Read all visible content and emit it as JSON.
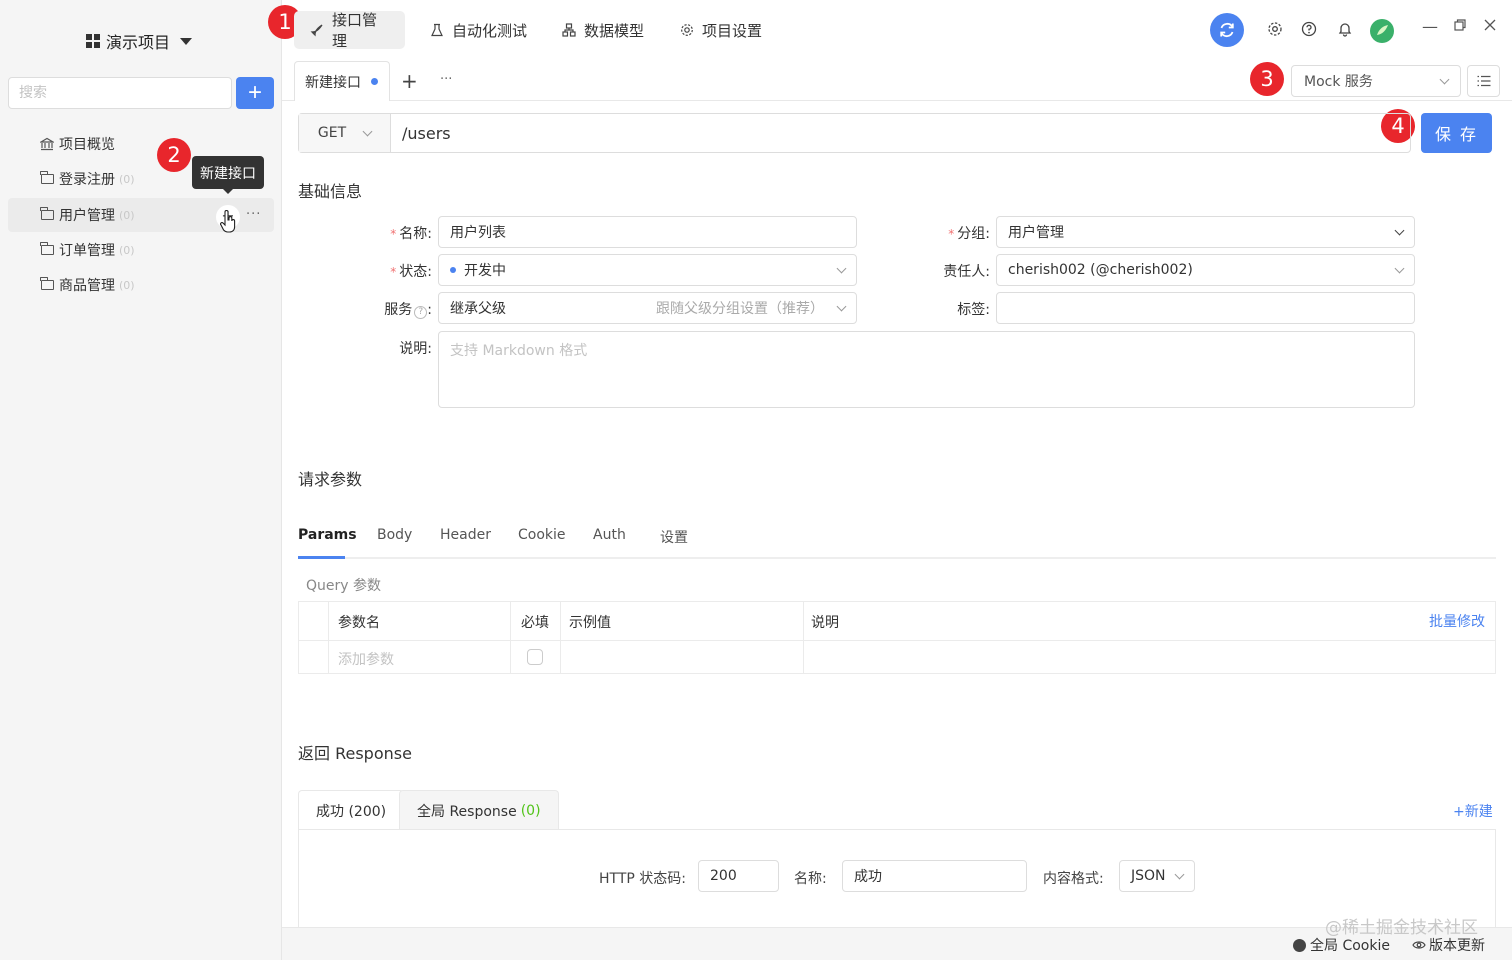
{
  "sidebar": {
    "project_name": "演示项目",
    "search_placeholder": "搜索",
    "add_label": "+",
    "items": [
      {
        "label": "项目概览",
        "count": ""
      },
      {
        "label": "登录注册",
        "count": "(0)"
      },
      {
        "label": "用户管理",
        "count": "(0)"
      },
      {
        "label": "订单管理",
        "count": "(0)"
      },
      {
        "label": "商品管理",
        "count": "(0)"
      }
    ],
    "tooltip": "新建接口"
  },
  "badges": [
    "1",
    "2",
    "3",
    "4"
  ],
  "top_nav": {
    "tabs": [
      "接口管理",
      "自动化测试",
      "数据模型",
      "项目设置"
    ]
  },
  "tabs": {
    "open_tab": "新建接口",
    "add": "+",
    "more": "···",
    "mock_service": "Mock 服务"
  },
  "request": {
    "method": "GET",
    "url": "/users",
    "save_label": "保 存"
  },
  "basic_info": {
    "title": "基础信息",
    "name_label": "名称:",
    "name_value": "用户列表",
    "group_label": "分组:",
    "group_value": "用户管理",
    "status_label": "状态:",
    "status_value": "开发中",
    "owner_label": "责任人:",
    "owner_value": "cherish002 (@cherish002)",
    "service_label": "服务",
    "service_value": "继承父级",
    "service_hint": "跟随父级分组设置（推荐）",
    "tags_label": "标签:",
    "desc_label": "说明:",
    "desc_placeholder": "支持 Markdown 格式",
    "help_mark": "?"
  },
  "request_params": {
    "title": "请求参数",
    "tabs": [
      "Params",
      "Body",
      "Header",
      "Cookie",
      "Auth",
      "设置"
    ],
    "query_label": "Query 参数",
    "columns": [
      "参数名",
      "必填",
      "示例值",
      "说明"
    ],
    "batch_edit": "批量修改",
    "add_param_placeholder": "添加参数"
  },
  "response": {
    "title": "返回 Response",
    "tab_success": "成功 (200)",
    "tab_global": "全局 Response",
    "tab_global_count": "(0)",
    "new_label": "+新建",
    "status_code_label": "HTTP 状态码:",
    "status_code_value": "200",
    "name_label": "名称:",
    "name_value": "成功",
    "content_type_label": "内容格式:",
    "content_type_value": "JSON"
  },
  "footer": {
    "watermark": "@稀土掘金技术社区",
    "cookie": "全局 Cookie",
    "update": "版本更新"
  },
  "colors": {
    "accent": "#4b83f0",
    "badge": "#e8262c",
    "status_green": "#52c41a"
  }
}
